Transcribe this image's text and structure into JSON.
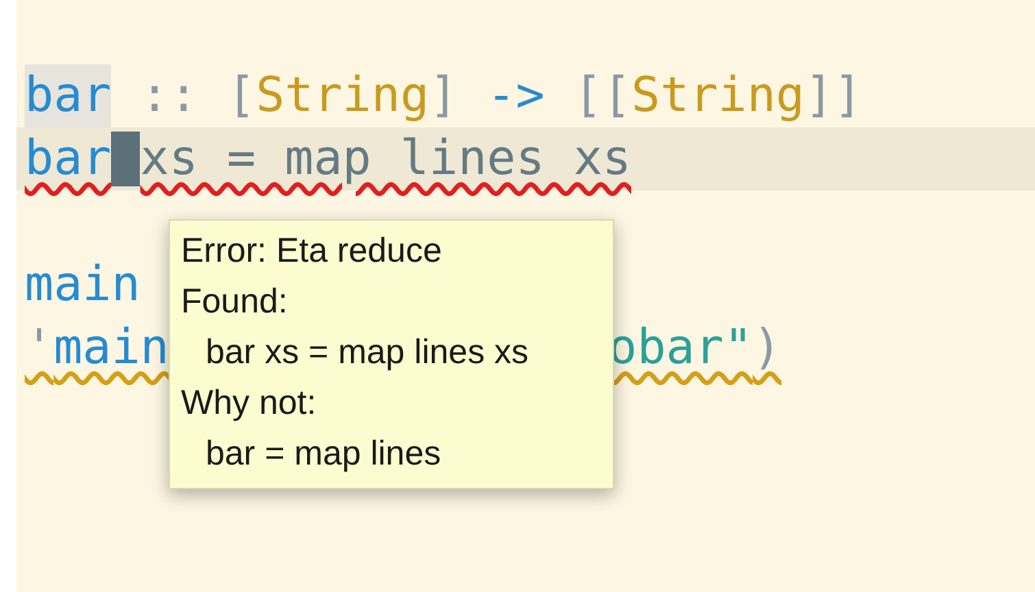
{
  "editor": {
    "lines": [
      {
        "current": false,
        "error": false,
        "warning": false,
        "tokens": [
          {
            "text": "bar",
            "kind": "name",
            "highlighted": true
          },
          {
            "text": " ::",
            "kind": "punct"
          },
          {
            "text": " [",
            "kind": "punct"
          },
          {
            "text": "String",
            "kind": "type"
          },
          {
            "text": "]",
            "kind": "punct"
          },
          {
            "text": " ->",
            "kind": "keyword"
          },
          {
            "text": " [[",
            "kind": "punct"
          },
          {
            "text": "String",
            "kind": "type"
          },
          {
            "text": "]]",
            "kind": "punct"
          }
        ]
      },
      {
        "current": true,
        "error": true,
        "warning": false,
        "tokens": [
          {
            "text": "bar",
            "kind": "name",
            "cursor_after": true
          },
          {
            "text": "xs = map lines xs",
            "kind": "plain"
          }
        ]
      },
      {
        "current": false
      },
      {
        "current": false,
        "error": false,
        "warning": false,
        "tokens": [
          {
            "text": "main",
            "kind": "name"
          }
        ]
      },
      {
        "current": false,
        "error": false,
        "warning": true,
        "tokens": [
          {
            "text": "'",
            "kind": "punct"
          },
          {
            "text": "main",
            "kind": "name"
          },
          {
            "text": "obar\"",
            "kind": "string",
            "after_popup": true
          },
          {
            "text": ")",
            "kind": "punct"
          }
        ]
      }
    ]
  },
  "tooltip": {
    "lines": [
      {
        "text": "Error: Eta reduce",
        "indented": false
      },
      {
        "text": "Found:",
        "indented": false
      },
      {
        "text": "bar xs = map lines xs",
        "indented": true
      },
      {
        "text": "Why not:",
        "indented": false
      },
      {
        "text": "bar = map lines",
        "indented": true
      }
    ]
  }
}
